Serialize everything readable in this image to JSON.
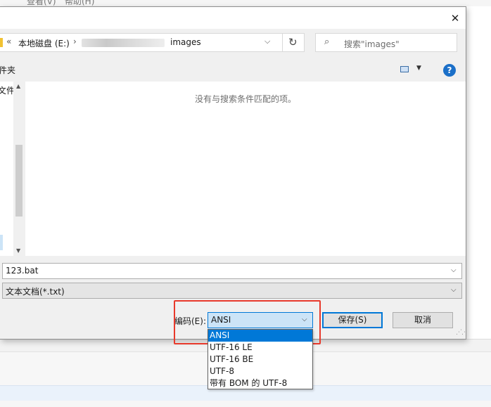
{
  "background": {
    "menu_items": [
      "查看(V)",
      "帮助(H)"
    ]
  },
  "dialog": {
    "close_glyph": "✕",
    "address": {
      "root": "本地磁盘 (E:)",
      "current": "images"
    },
    "search": {
      "placeholder": "搜索\"images\""
    },
    "toolbar": {
      "new_folder": "件夹"
    },
    "nav": {
      "item_top": "文件",
      "item_bottom": ")"
    },
    "file_list": {
      "empty_message": "没有与搜索条件匹配的项。"
    },
    "file_name": {
      "value": "123.bat"
    },
    "file_type": {
      "value": "文本文档(*.txt)"
    },
    "encoding": {
      "label": "编码(E):",
      "selected": "ANSI",
      "options": [
        "ANSI",
        "UTF-16 LE",
        "UTF-16 BE",
        "UTF-8",
        "带有 BOM 的 UTF-8"
      ]
    },
    "buttons": {
      "save": "保存(S)",
      "cancel": "取消"
    }
  },
  "colors": {
    "accent": "#0078d7",
    "highlight_box": "#e8392b",
    "help_icon": "#1b6fc8"
  }
}
